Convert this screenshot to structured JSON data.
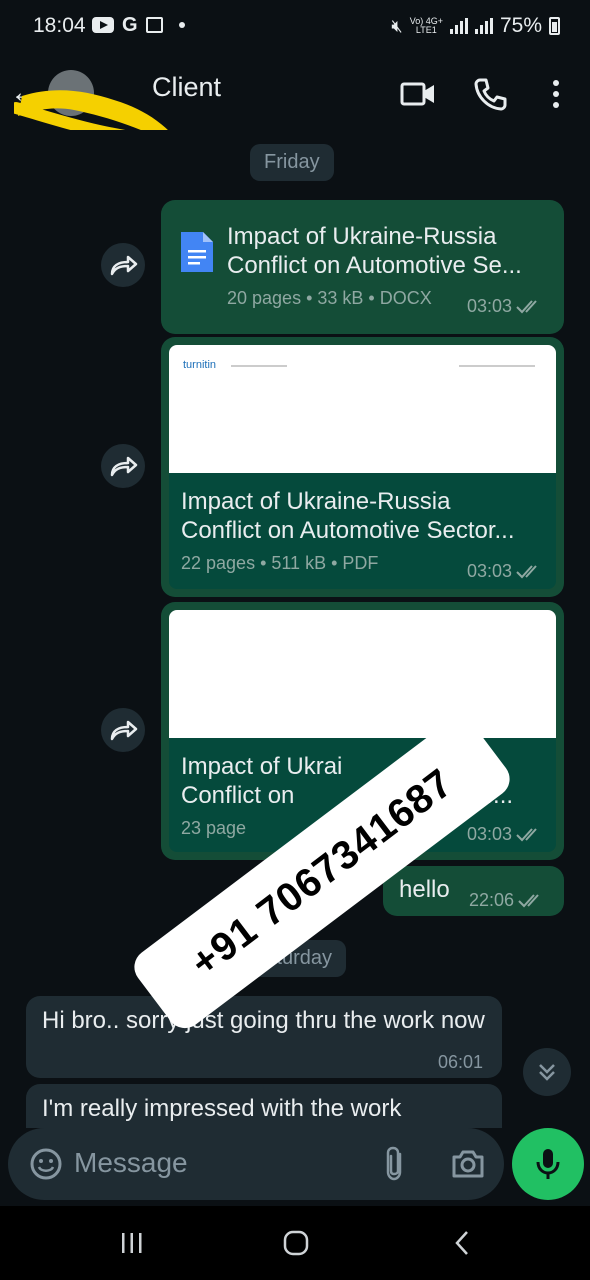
{
  "status_bar": {
    "time": "18:04",
    "network": "Vo) 4G+",
    "network_sub": "LTE1",
    "battery": "75%"
  },
  "header": {
    "contact_name": "Client"
  },
  "chat": {
    "day_chips": [
      "Friday",
      "Saturday"
    ],
    "messages": [
      {
        "type": "document",
        "title_line1": "Impact of Ukraine-Russia",
        "title_line2": "Conflict on Automotive Se...",
        "meta": "20 pages • 33 kB • DOCX",
        "time": "03:03"
      },
      {
        "type": "document",
        "preview_brand": "turnitin",
        "title_line1": "Impact of Ukraine-Russia",
        "title_line2": "Conflict on Automotive Sector...",
        "meta": "22 pages • 511 kB • PDF",
        "time": "03:03"
      },
      {
        "type": "document",
        "title_line1": "Impact of Ukrai",
        "title_line2": "Conflict on",
        "title_line2_tail": "Sector...",
        "meta": "23 page",
        "time": "03:03"
      },
      {
        "type": "text_out",
        "text": "hello",
        "time": "22:06"
      },
      {
        "type": "text_in",
        "text": "Hi bro.. sorry just going thru the work now",
        "time": "06:01"
      },
      {
        "type": "text_in",
        "text": "I'm really impressed with the work"
      }
    ]
  },
  "watermark": {
    "text": "+91 7067341687"
  },
  "composer": {
    "placeholder": "Message"
  },
  "colors": {
    "background": "#0b1014",
    "outgoing_bubble": "#144d37",
    "incoming_bubble": "#1f2c33",
    "accent_green": "#21c063",
    "doc_icon_blue": "#4285f4"
  },
  "icons": [
    "back-arrow-icon",
    "video-call-icon",
    "voice-call-icon",
    "more-options-icon",
    "forward-icon",
    "document-icon",
    "double-check-icon",
    "scroll-down-icon",
    "emoji-icon",
    "attach-icon",
    "camera-icon",
    "mic-icon",
    "nav-recents-icon",
    "nav-home-icon",
    "nav-back-icon"
  ]
}
